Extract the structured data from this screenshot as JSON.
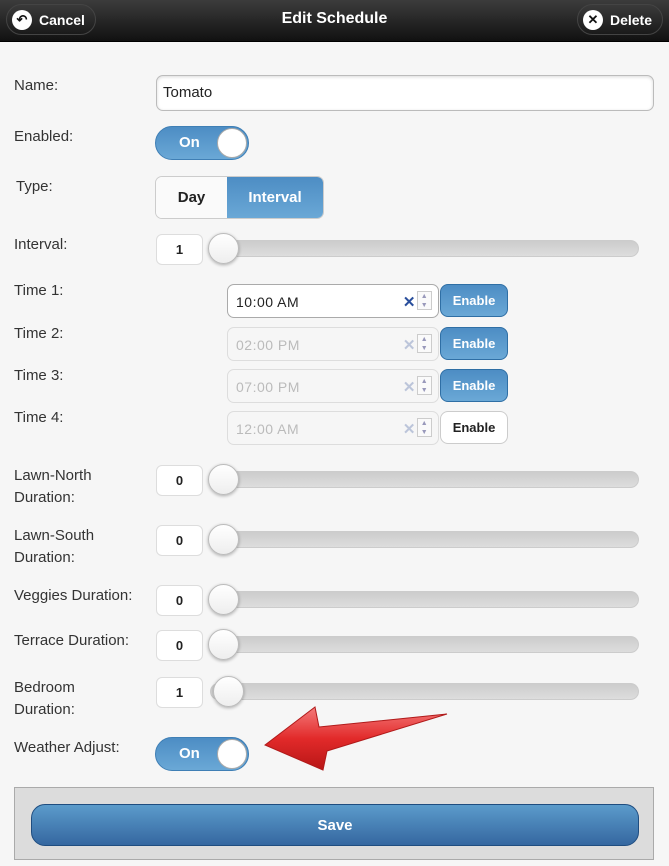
{
  "header": {
    "title": "Edit Schedule",
    "cancel_label": "Cancel",
    "delete_label": "Delete"
  },
  "form": {
    "name_label": "Name:",
    "name_value": "Tomato",
    "enabled_label": "Enabled:",
    "enabled_value": "On",
    "type_label": "Type:",
    "type_options": [
      "Day",
      "Interval"
    ],
    "type_selected": "Interval",
    "interval_label": "Interval:",
    "interval_value": "1",
    "times": [
      {
        "label": "Time 1:",
        "value": "10:00 AM",
        "button": "Enable",
        "enabled": true,
        "button_active": true
      },
      {
        "label": "Time 2:",
        "value": "02:00 PM",
        "button": "Enable",
        "enabled": false,
        "button_active": true
      },
      {
        "label": "Time 3:",
        "value": "07:00 PM",
        "button": "Enable",
        "enabled": false,
        "button_active": true
      },
      {
        "label": "Time 4:",
        "value": "12:00 AM",
        "button": "Enable",
        "enabled": false,
        "button_active": false
      }
    ],
    "durations": [
      {
        "label": "Lawn-North Duration:",
        "value": "0"
      },
      {
        "label": "Lawn-South Duration:",
        "value": "0"
      },
      {
        "label": "Veggies Duration:",
        "value": "0"
      },
      {
        "label": "Terrace Duration:",
        "value": "0"
      },
      {
        "label": "Bedroom Duration:",
        "value": "1"
      }
    ],
    "weather_label": "Weather Adjust:",
    "weather_value": "On"
  },
  "footer": {
    "save_label": "Save"
  },
  "colors": {
    "accent": "#5b9bcb",
    "header": "#1a1a1a",
    "arrow": "#e02a2a"
  }
}
